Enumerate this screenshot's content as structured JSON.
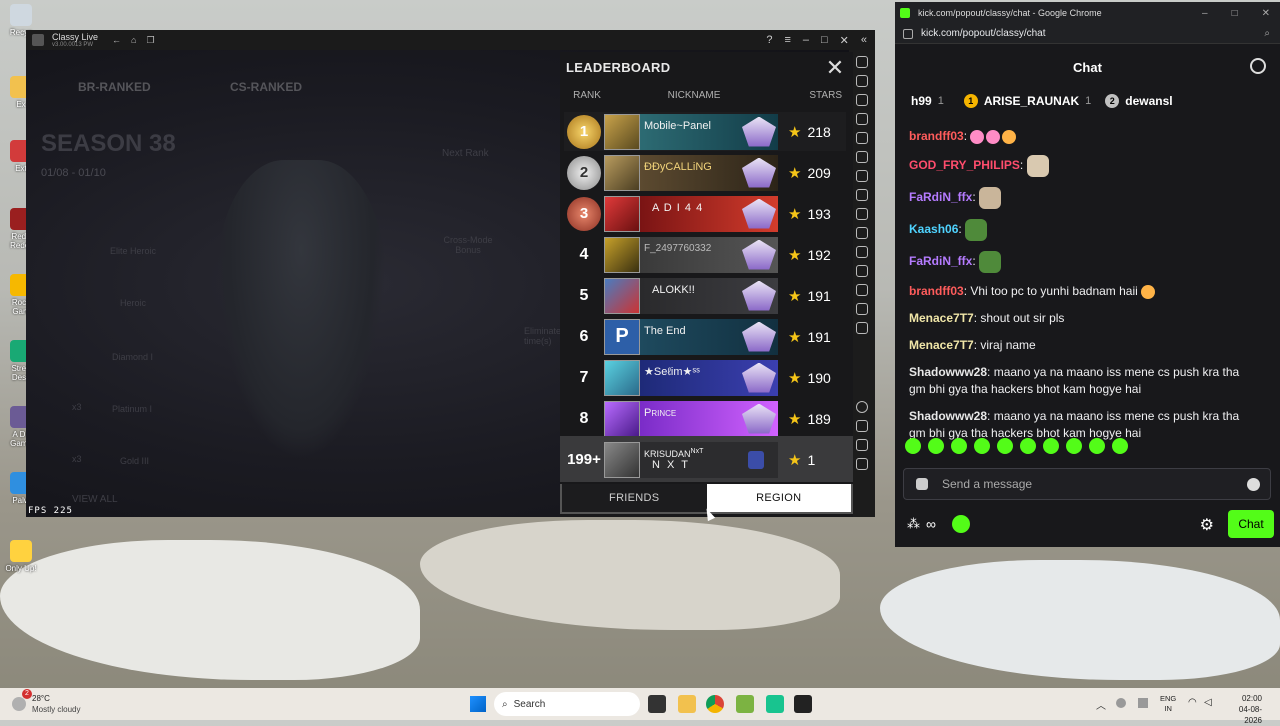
{
  "desktop": {
    "icons": [
      "Recyc",
      "Ex",
      "Ext",
      "Red I Reder",
      "Rock Gam",
      "Strea Desk",
      "A Dif Game",
      "Palw",
      "Only Up!"
    ]
  },
  "emulator": {
    "title": "Classy Live",
    "subtitle": "v3.00.0013 PW",
    "game": {
      "tab_br": "BR-RANKED",
      "tab_cs": "CS-RANKED",
      "season": "SEASON 38",
      "dates": "01/08 - 01/10",
      "next_rank": "Next Rank",
      "cross_mode": "Cross-Mode Bonus",
      "eliminate": "Eliminate time(s)",
      "ranks": [
        "Elite Heroic",
        "Heroic",
        "Diamond I",
        "Platinum I",
        "Gold III"
      ],
      "x3a": "x3",
      "x3b": "x3",
      "view_all": "VIEW ALL",
      "fps": "FPS 225"
    },
    "leaderboard": {
      "title": "LEADERBOARD",
      "col_rank": "RANK",
      "col_nickname": "NICKNAME",
      "col_stars": "STARS",
      "rows": [
        {
          "rank": "1",
          "name": "Mobile~Panel",
          "stars": "218"
        },
        {
          "rank": "2",
          "name": "ĐĐyCALLiNG",
          "stars": "209"
        },
        {
          "rank": "3",
          "name": "A D I 4 4",
          "stars": "193"
        },
        {
          "rank": "4",
          "name": "F_2497760332",
          "stars": "192"
        },
        {
          "rank": "5",
          "name": "ALOKK!!",
          "stars": "191"
        },
        {
          "rank": "6",
          "name": "The End",
          "stars": "191"
        },
        {
          "rank": "7",
          "name": "★Seℓim★ˢˢ",
          "stars": "190"
        },
        {
          "rank": "8",
          "name": "Prince",
          "stars": "189"
        }
      ],
      "me": {
        "rank": "199+",
        "name": "KRISUDAN",
        "tag": "NxT",
        "sub": "N X T",
        "stars": "1"
      },
      "tab_friends": "FRIENDS",
      "tab_region": "REGION"
    }
  },
  "chrome": {
    "title": "kick.com/popout/classy/chat - Google Chrome",
    "url": "kick.com/popout/classy/chat",
    "chat": {
      "header": "Chat",
      "gifters": [
        {
          "name": "h99",
          "count": "1"
        },
        {
          "name": "ARISE_RAUNAK",
          "count": "1",
          "badge": "1"
        },
        {
          "name": "dewansl",
          "count": "",
          "badge": "2"
        }
      ],
      "messages": [
        {
          "user": "brandff03",
          "color": "#ff5c5c",
          "text": ""
        },
        {
          "user": "GOD_FRY_PHILIPS",
          "color": "#ff4d6d",
          "text": ""
        },
        {
          "user": "FaRdiN_ffx",
          "color": "#b57bff",
          "text": ""
        },
        {
          "user": "Kaash06",
          "color": "#4fd3ff",
          "text": ""
        },
        {
          "user": "FaRdiN_ffx",
          "color": "#b57bff",
          "text": ""
        },
        {
          "user": "brandff03",
          "color": "#ff5c5c",
          "text": "Vhi too pc to yunhi badnam haii"
        },
        {
          "user": "Menace7T7",
          "color": "#f0e6a8",
          "text": "shout out sir pls"
        },
        {
          "user": "Menace7T7",
          "color": "#f0e6a8",
          "text": "viraj name"
        },
        {
          "user": "Shadowww28",
          "color": "#e8e8e8",
          "text": "maano ya na maano iss mene cs push kra tha gm bhi gya tha hackers bhot kam hogye hai"
        },
        {
          "user": "Shadowww28",
          "color": "#e8e8e8",
          "text": "maano ya na maano iss mene cs push kra tha gm bhi gya tha hackers bhot kam hogye hai"
        }
      ],
      "placeholder": "Send a message",
      "send_label": "Chat"
    }
  },
  "taskbar": {
    "weather_temp": "28°C",
    "weather_desc": "Mostly cloudy",
    "search": "Search",
    "lang1": "ENG",
    "lang2": "IN",
    "time": "02:00",
    "date": "04-08-2026",
    "notif": "2"
  }
}
